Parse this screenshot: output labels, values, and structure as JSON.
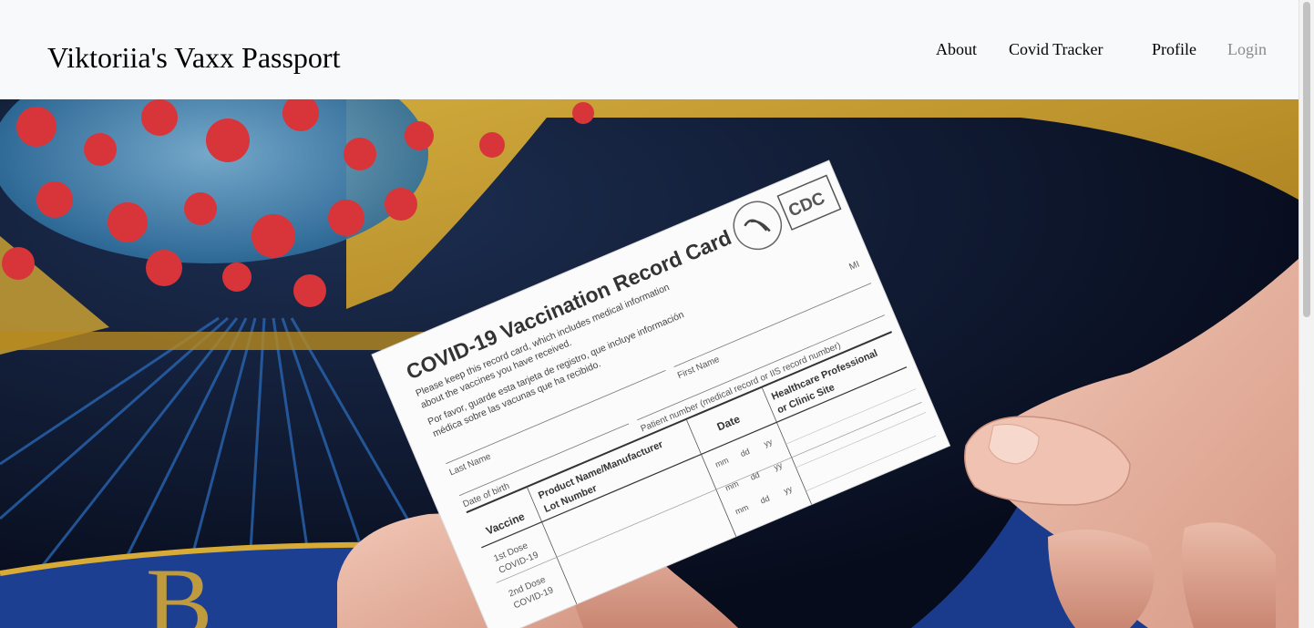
{
  "navbar": {
    "brand": "Viktoriia's Vaxx Passport",
    "links": [
      {
        "label": "About"
      },
      {
        "label": "Covid Tracker"
      },
      {
        "label": "Profile"
      },
      {
        "label": "Login"
      }
    ]
  },
  "hero": {
    "card": {
      "title": "COVID-19 Vaccination Record Card",
      "intro_en_1": "Please keep this record card, which includes medical information",
      "intro_en_2": "about the vaccines you have received.",
      "intro_es_1": "Por favor, guarde esta tarjeta de registro, que incluye información",
      "intro_es_2": "médica sobre las vacunas que ha recibido.",
      "logo": "CDC",
      "field_last_name": "Last Name",
      "field_first_name": "First Name",
      "field_mi": "MI",
      "field_dob": "Date of birth",
      "field_patient_number": "Patient number (medical record or IIS record number)",
      "col_vaccine": "Vaccine",
      "col_product": "Product Name/Manufacturer",
      "col_lot": "Lot Number",
      "col_date": "Date",
      "col_site_1": "Healthcare Professional",
      "col_site_2": "or Clinic Site",
      "row1_dose": "1st Dose",
      "row1_name": "COVID-19",
      "row2_dose": "2nd Dose",
      "row2_name": "COVID-19",
      "date_mm": "mm",
      "date_dd": "dd",
      "date_yy": "yy"
    }
  }
}
